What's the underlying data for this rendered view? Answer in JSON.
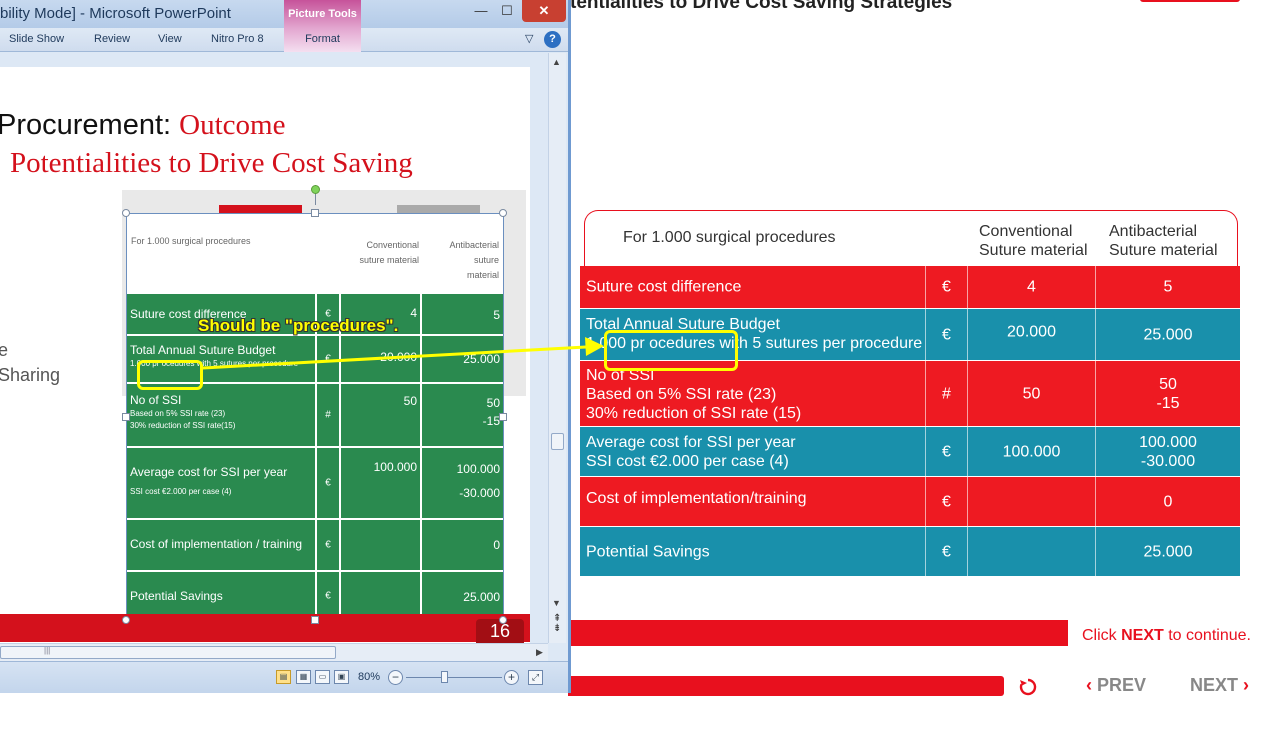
{
  "page": {
    "title": "tentialities to Drive Cost Saving Strategies"
  },
  "table": {
    "header": {
      "label": "For 1.000 surgical procedures",
      "col1_line1": "Conventional",
      "col1_line2": "Suture material",
      "col2_line1": "Antibacterial",
      "col2_line2": "Suture material"
    },
    "rows": [
      {
        "label_line1": "Suture cost difference",
        "unit": "€",
        "conv": "4",
        "anti_line1": "5",
        "color": "#ee1a22"
      },
      {
        "label_line1": "Total Annual Suture Budget",
        "label_line2": "1.000 pr ocedures with 5 sutures per procedure",
        "unit": "€",
        "conv": "20.000",
        "anti_line1": "25.000",
        "color": "#1990ab"
      },
      {
        "label_line1": "No of SSI",
        "label_line2": "Based on 5% SSI rate (23)",
        "label_line3": "30% reduction of SSI rate (15)",
        "unit": "#",
        "conv": "50",
        "anti_line1": "50",
        "anti_line2": "-15",
        "color": "#ee1a22"
      },
      {
        "label_line1": "Average cost for SSI per year",
        "label_line2": "SSI cost €2.000 per case (4)",
        "unit": "€",
        "conv": "100.000",
        "anti_line1": "100.000",
        "anti_line2": "-30.000",
        "color": "#1990ab"
      },
      {
        "label_line1": "Cost of implementation/training",
        "unit": "€",
        "conv": "",
        "anti_line1": "0",
        "color": "#ee1a22"
      },
      {
        "label_line1": "Potential Savings",
        "unit": "€",
        "conv": "",
        "anti_line1": "25.000",
        "color": "#1990ab"
      }
    ]
  },
  "footer": {
    "click_prefix": "Click ",
    "click_next": "NEXT",
    "click_suffix": " to continue.",
    "prev_label": "PREV",
    "next_label": "NEXT",
    "prev_chevron": "‹",
    "next_chevron": "›",
    "replay_icon": "replay-icon"
  },
  "ppt": {
    "window_title": "bility Mode]  -  Microsoft PowerPoint",
    "picture_tools": "Picture Tools",
    "tabs": [
      "Slide Show",
      "Review",
      "View",
      "Nitro Pro 8",
      "Format"
    ],
    "minimize": "—",
    "maximize": "☐",
    "close": "✕",
    "collapse": "▽",
    "help": "?",
    "slide": {
      "title_black": "Procurement: ",
      "title_red": "Outcome",
      "subtitle_red": "Potentialities to Drive Cost Saving",
      "side_text1": "e",
      "side_text2": "Sharing",
      "slide_number": "16",
      "table": {
        "header": {
          "label": "For 1.000 surgical procedures",
          "col1_line1": "Conventional",
          "col1_line2": "suture material",
          "col2_line1": "Antibacterial suture",
          "col2_line2": "material"
        },
        "rows": [
          {
            "label": "Suture cost difference",
            "sub1": "",
            "sub2": "",
            "unit": "€",
            "conv": "4",
            "anti": "5",
            "anti2": ""
          },
          {
            "label": "Total Annual Suture Budget",
            "sub1": "1.000 pr ocedures with 5 sutures per procedure",
            "sub2": "",
            "unit": "€",
            "conv": "20.000",
            "anti": "25.000",
            "anti2": ""
          },
          {
            "label": "No of SSI",
            "sub1": "Based on 5% SSI rate (23)",
            "sub2": "30% reduction of SSI rate(15)",
            "unit": "#",
            "conv": "50",
            "anti": "50",
            "anti2": "-15"
          },
          {
            "label": "Average cost for SSI per year",
            "sub1": "SSI cost €2.000 per case (4)",
            "sub2": "",
            "unit": "€",
            "conv": "100.000",
            "anti": "100.000",
            "anti2": "-30.000"
          },
          {
            "label": "Cost of implementation / training",
            "sub1": "",
            "sub2": "",
            "unit": "€",
            "conv": "",
            "anti": "0",
            "anti2": ""
          },
          {
            "label": "Potential Savings",
            "sub1": "",
            "sub2": "",
            "unit": "€",
            "conv": "",
            "anti": "25.000",
            "anti2": ""
          }
        ]
      }
    },
    "zoom": "80%",
    "zoom_level_percent": 80
  },
  "annotation": {
    "callout": "Should be \"procedures\".",
    "color": "#ffff00"
  },
  "colors": {
    "brand_red": "#e8101e",
    "row_red": "#ee1a22",
    "row_teal": "#1990ab",
    "slide_green": "#2a8a4f"
  }
}
